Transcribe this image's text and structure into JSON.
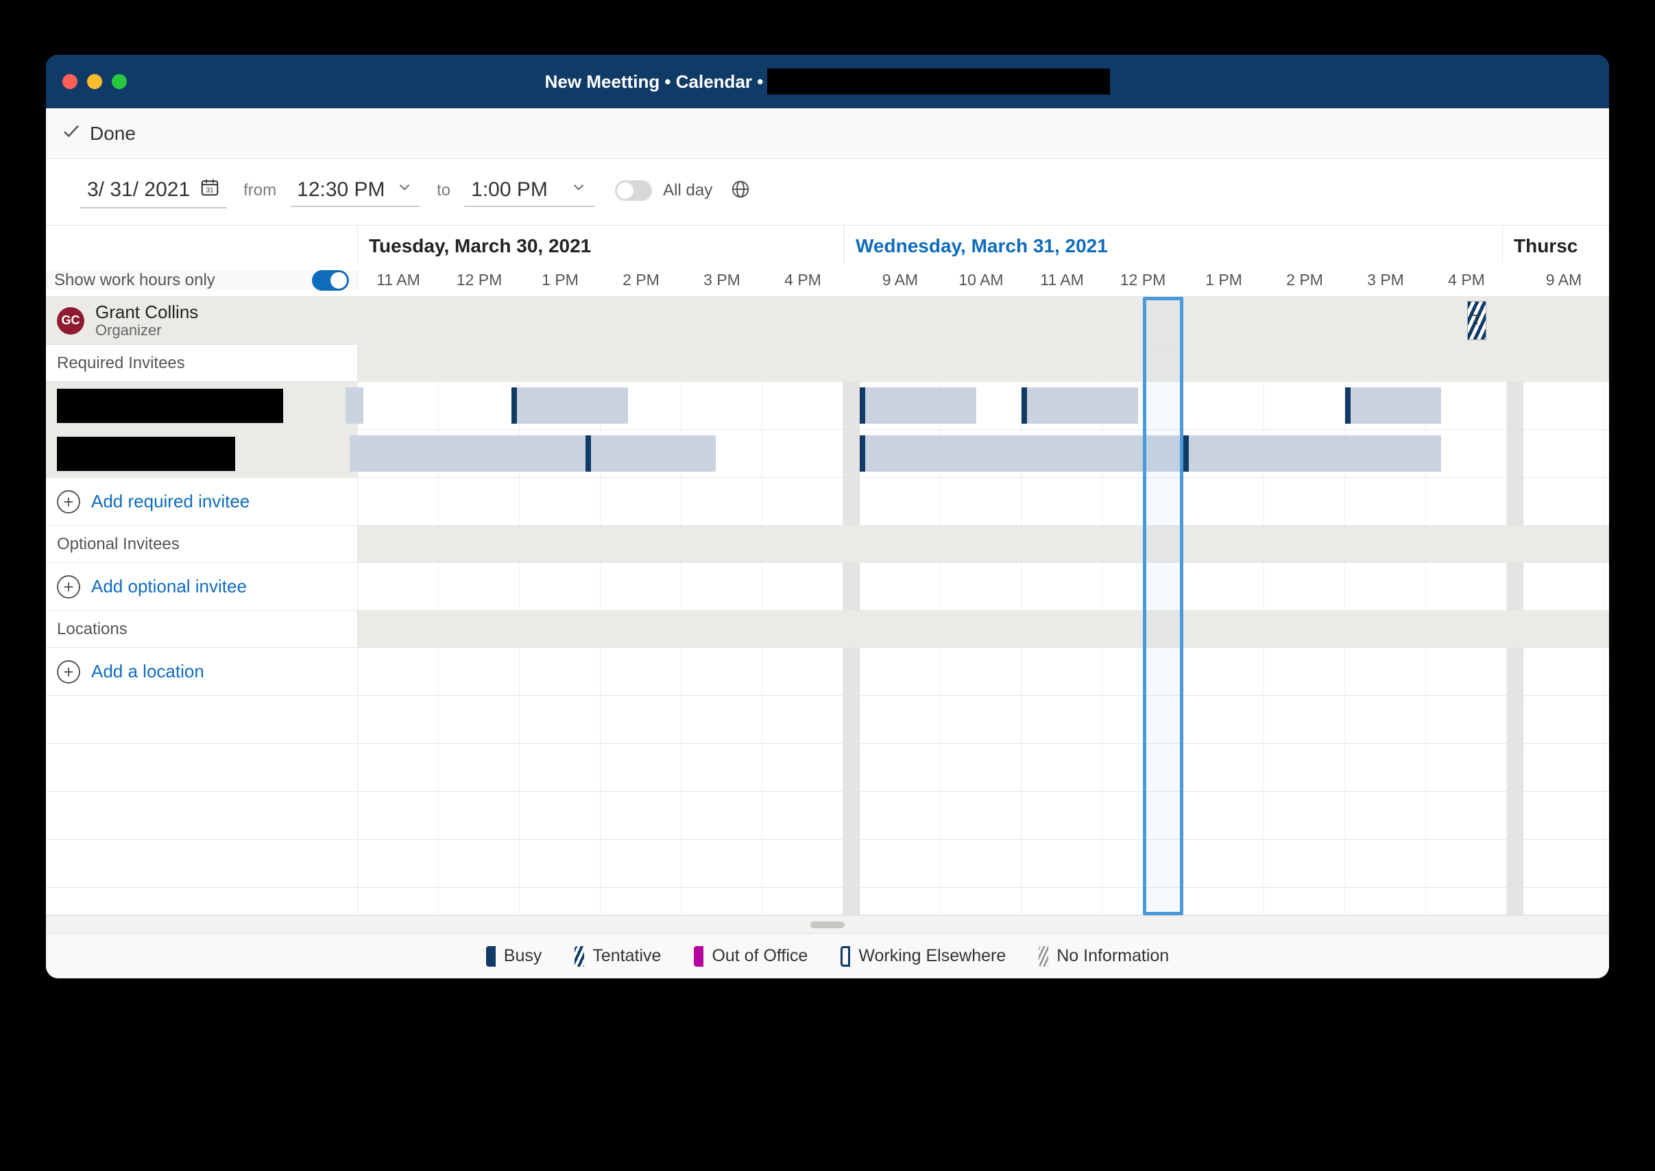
{
  "window": {
    "title_prefix": "New Meetting • Calendar •"
  },
  "toolbar": {
    "done_label": "Done"
  },
  "options": {
    "date": "3/ 31/ 2021",
    "from_label": "from",
    "from_time": "12:30 PM",
    "to_label": "to",
    "to_time": "1:00 PM",
    "all_day_label": "All day"
  },
  "days": {
    "d1": "Tuesday, March 30, 2021",
    "d2": "Wednesday, March 31, 2021",
    "d3": "Thursc"
  },
  "hours_d1": [
    "11 AM",
    "12 PM",
    "1 PM",
    "2 PM",
    "3 PM",
    "4 PM"
  ],
  "hours_d2": [
    "9 AM",
    "10 AM",
    "11 AM",
    "12 PM",
    "1 PM",
    "2 PM",
    "3 PM",
    "4 PM"
  ],
  "hours_d3": [
    "9 AM"
  ],
  "sidebar": {
    "work_hours_label": "Show work hours only",
    "organizer_initials": "GC",
    "organizer_name": "Grant Collins",
    "organizer_role": "Organizer",
    "required_label": "Required Invitees",
    "add_required": "Add required invitee",
    "optional_label": "Optional Invitees",
    "add_optional": "Add optional invitee",
    "locations_label": "Locations",
    "add_location": "Add a location"
  },
  "tentative_badge": "T",
  "legend": {
    "busy": "Busy",
    "tentative": "Tentative",
    "oof": "Out of Office",
    "we": "Working Elsewhere",
    "noinfo": "No Information"
  }
}
